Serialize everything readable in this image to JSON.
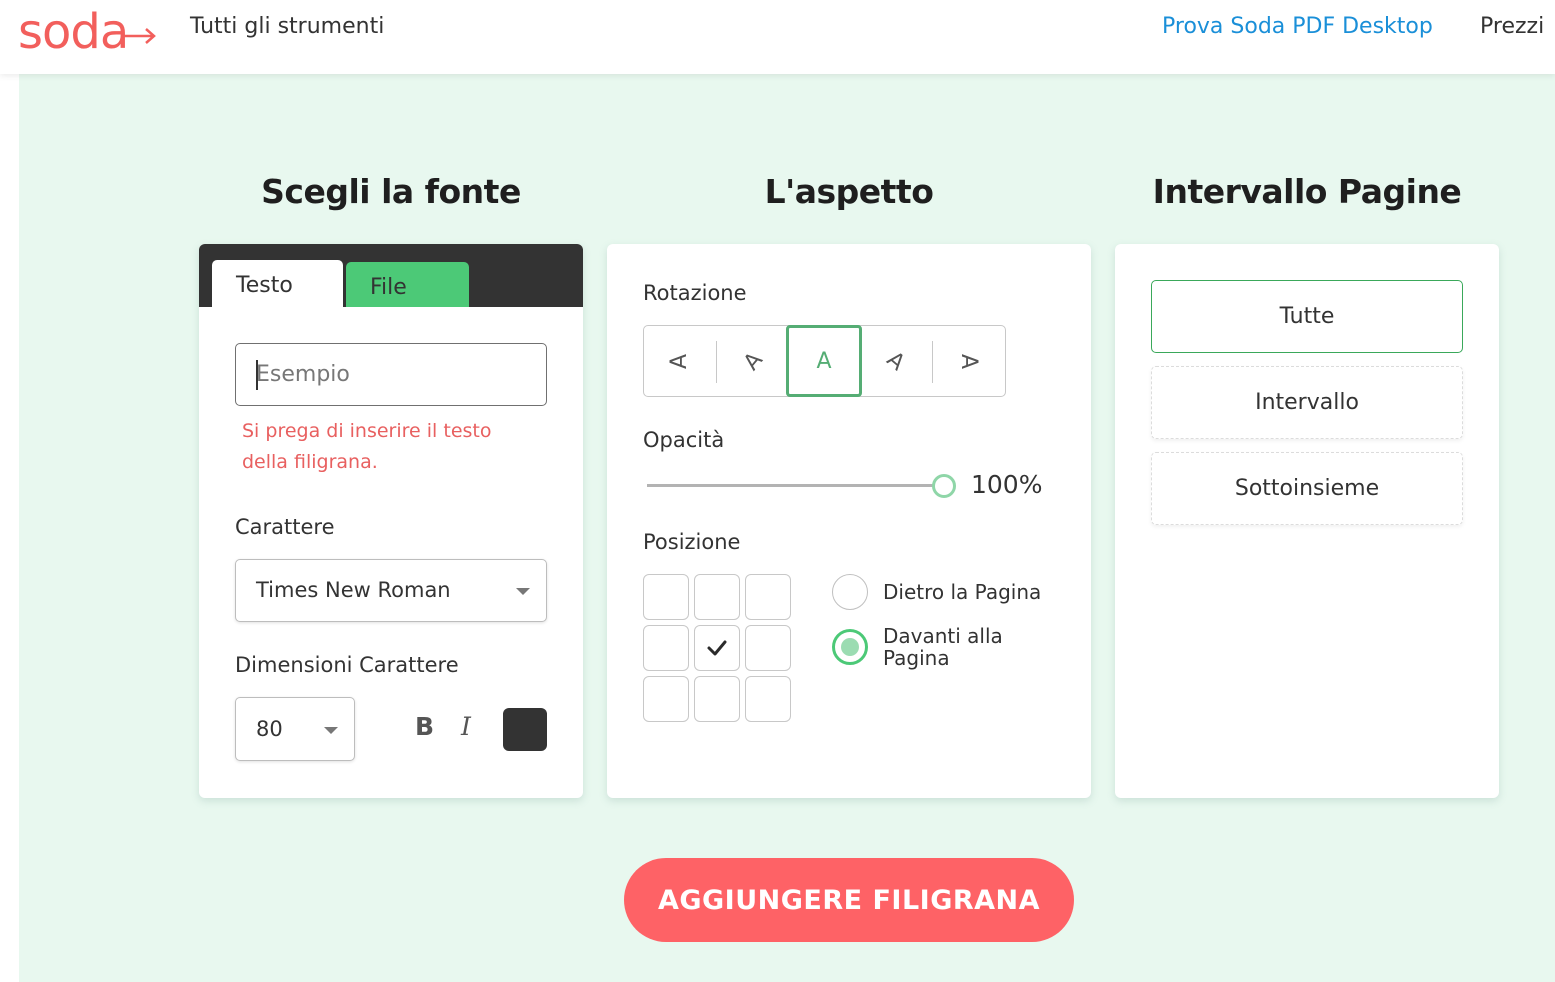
{
  "header": {
    "logo_text": "soda",
    "nav_all_tools": "Tutti gli strumenti",
    "nav_try_desktop": "Prova Soda PDF Desktop",
    "nav_pricing": "Prezzi"
  },
  "colors": {
    "brand": "#f25f5c",
    "accent_green": "#4cc977",
    "link_blue": "#1a8fd8",
    "background": "#e8f8ef",
    "cta": "#fe6266",
    "error": "#e86060"
  },
  "source": {
    "title": "Scegli la fonte",
    "tabs": [
      {
        "label": "Testo",
        "active": true
      },
      {
        "label": "File",
        "active": false
      }
    ],
    "text_input": {
      "value": "",
      "placeholder": "Esempio"
    },
    "error_message": "Si prega di inserire il testo della filigrana.",
    "font_label": "Carattere",
    "font_value": "Times New Roman",
    "size_label": "Dimensioni Carattere",
    "size_value": "80",
    "bold_label": "B",
    "italic_label": "I",
    "text_color": "#333333"
  },
  "appearance": {
    "title": "L'aspetto",
    "rotation_label": "Rotazione",
    "rotation_options": [
      {
        "glyph": "A",
        "angle_deg": -90,
        "selected": false
      },
      {
        "glyph": "A",
        "angle_deg": -45,
        "selected": false
      },
      {
        "glyph": "A",
        "angle_deg": 0,
        "selected": true
      },
      {
        "glyph": "A",
        "angle_deg": 45,
        "selected": false
      },
      {
        "glyph": "A",
        "angle_deg": 90,
        "selected": false
      }
    ],
    "opacity_label": "Opacità",
    "opacity_percent": 100,
    "opacity_value_text": "100%",
    "position_label": "Posizione",
    "position_grid_selected": {
      "row": 1,
      "col": 1
    },
    "layer_options": [
      {
        "label": "Dietro la Pagina",
        "selected": false
      },
      {
        "label": "Davanti alla Pagina",
        "selected": true
      }
    ]
  },
  "page_range": {
    "title": "Intervallo Pagine",
    "options": [
      {
        "label": "Tutte",
        "selected": true
      },
      {
        "label": "Intervallo",
        "selected": false
      },
      {
        "label": "Sottoinsieme",
        "selected": false
      }
    ]
  },
  "cta": {
    "label": "AGGIUNGERE FILIGRANA"
  }
}
